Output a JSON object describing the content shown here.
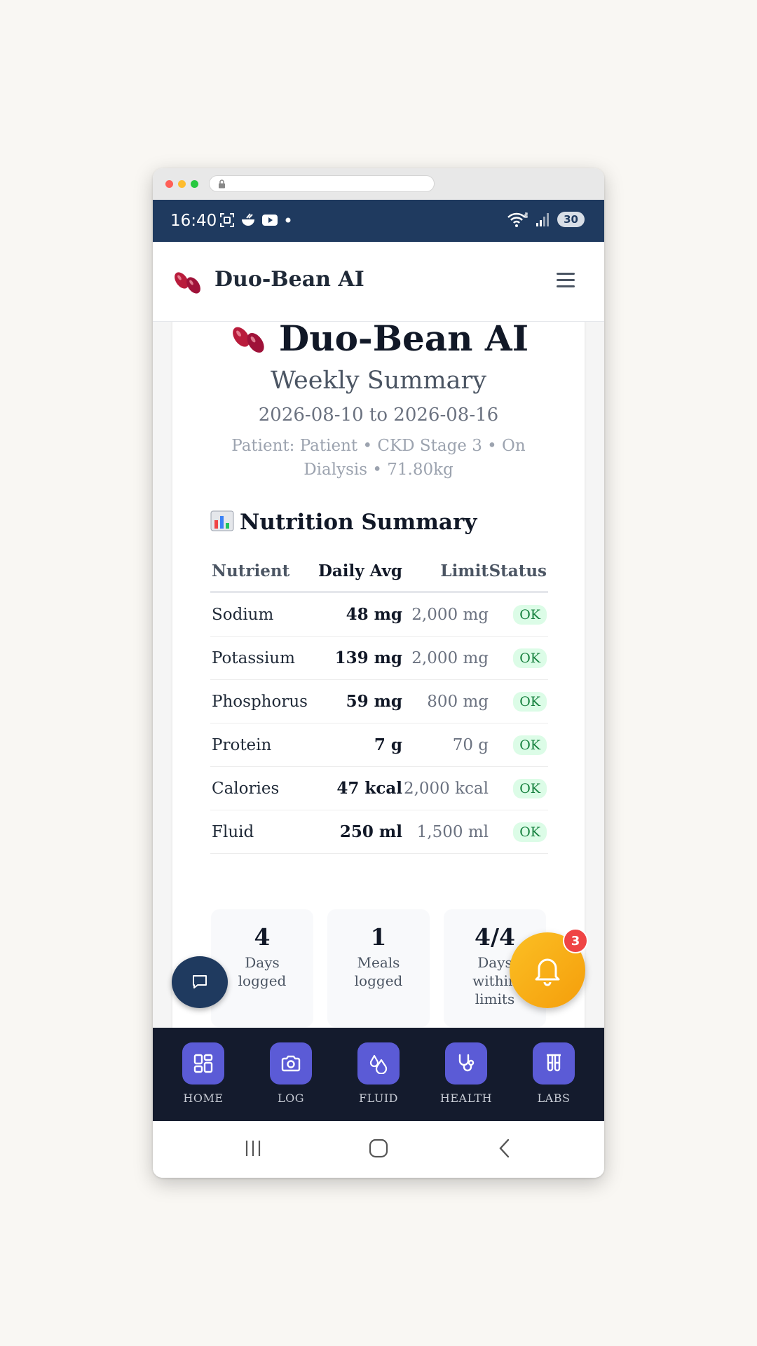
{
  "status_bar": {
    "time": "16:40",
    "battery": "30",
    "icons": [
      "screenshot-icon",
      "rice-bowl-icon",
      "youtube-icon",
      "dot-icon",
      "wifi-icon",
      "signal-icon"
    ]
  },
  "header": {
    "app_name": "Duo-Bean AI"
  },
  "hero": {
    "title": "Duo-Bean AI",
    "subtitle": "Weekly Summary",
    "date_range": "2026-08-10 to 2026-08-16",
    "patient_info": "Patient: Patient • CKD Stage 3 • On Dialysis • 71.80kg"
  },
  "nutrition": {
    "section_title": "Nutrition Summary",
    "columns": [
      "Nutrient",
      "Daily Avg",
      "Limit",
      "Status"
    ],
    "rows": [
      {
        "nutrient": "Sodium",
        "avg": "48 mg",
        "limit": "2,000 mg",
        "status": "OK"
      },
      {
        "nutrient": "Potassium",
        "avg": "139 mg",
        "limit": "2,000 mg",
        "status": "OK"
      },
      {
        "nutrient": "Phosphorus",
        "avg": "59 mg",
        "limit": "800 mg",
        "status": "OK"
      },
      {
        "nutrient": "Protein",
        "avg": "7 g",
        "limit": "70 g",
        "status": "OK"
      },
      {
        "nutrient": "Calories",
        "avg": "47 kcal",
        "limit": "2,000 kcal",
        "status": "OK"
      },
      {
        "nutrient": "Fluid",
        "avg": "250 ml",
        "limit": "1,500 ml",
        "status": "OK"
      }
    ]
  },
  "stats": [
    {
      "value": "4",
      "label_line1": "Days",
      "label_line2": "logged",
      "label_line3": ""
    },
    {
      "value": "1",
      "label_line1": "Meals",
      "label_line2": "logged",
      "label_line3": ""
    },
    {
      "value": "4/4",
      "label_line1": "Days",
      "label_line2": "within",
      "label_line3": "limits"
    }
  ],
  "notifications": {
    "count": "3"
  },
  "bottom_nav": [
    {
      "label": "HOME",
      "icon": "grid-icon"
    },
    {
      "label": "LOG",
      "icon": "camera-icon"
    },
    {
      "label": "FLUID",
      "icon": "droplets-icon"
    },
    {
      "label": "HEALTH",
      "icon": "stethoscope-icon"
    },
    {
      "label": "LABS",
      "icon": "test-tubes-icon"
    }
  ],
  "colors": {
    "status_bar": "#1f3a5f",
    "nav_bg": "#141b2d",
    "nav_button": "#5b5bd6",
    "ok_badge_bg": "#dcfce7",
    "ok_badge_text": "#15803d",
    "bell": "#f59e0b",
    "badge_red": "#ef4444"
  }
}
